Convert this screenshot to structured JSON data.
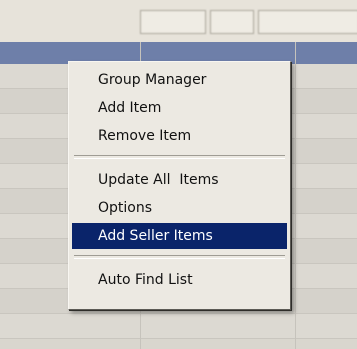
{
  "background": {
    "toolbar": {
      "buttons": []
    },
    "rows": [
      {},
      {},
      {},
      {},
      {},
      {},
      {},
      {},
      {},
      {},
      {}
    ]
  },
  "context_menu": {
    "items": [
      {
        "label": "Group Manager"
      },
      {
        "label": "Add Item"
      },
      {
        "label": "Remove Item"
      },
      {
        "label": "Update All  Items"
      },
      {
        "label": "Options"
      },
      {
        "label": "Add Seller Items",
        "selected": true
      },
      {
        "label": "Auto Find List"
      }
    ]
  },
  "colors": {
    "menu_background": "#ece9e2",
    "selection": "#0a246a",
    "selection_text": "#ffffff",
    "header_blue": "#6e7fa9"
  }
}
